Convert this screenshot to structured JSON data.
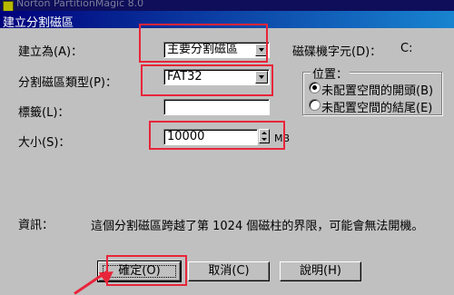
{
  "background_window": {
    "title": "Norton PartitionMagic 8.0"
  },
  "dialog": {
    "title": "建立分割磁區",
    "create_as": {
      "label": "建立為(A)：",
      "value": "主要分割磁區"
    },
    "drive_letter": {
      "label": "磁碟機字元(D)：",
      "value": "C:"
    },
    "partition_type": {
      "label": "分割磁區類型(P)：",
      "value": "FAT32"
    },
    "label_field": {
      "label": "標籤(L)：",
      "value": ""
    },
    "size": {
      "label": "大小(S)：",
      "value": "10000",
      "unit": "MB"
    },
    "position": {
      "legend": "位置：",
      "options": [
        {
          "label": "未配置空間的開頭(B)",
          "selected": true
        },
        {
          "label": "未配置空間的結尾(E)",
          "selected": false
        }
      ]
    },
    "info": {
      "label": "資訊：",
      "message": "這個分割磁區跨越了第 1024 個磁柱的界限，可能會無法開機。"
    },
    "buttons": {
      "ok": "確定(O)",
      "cancel": "取消(C)",
      "help": "說明(H)"
    }
  },
  "annotation_color": "#e8253a"
}
